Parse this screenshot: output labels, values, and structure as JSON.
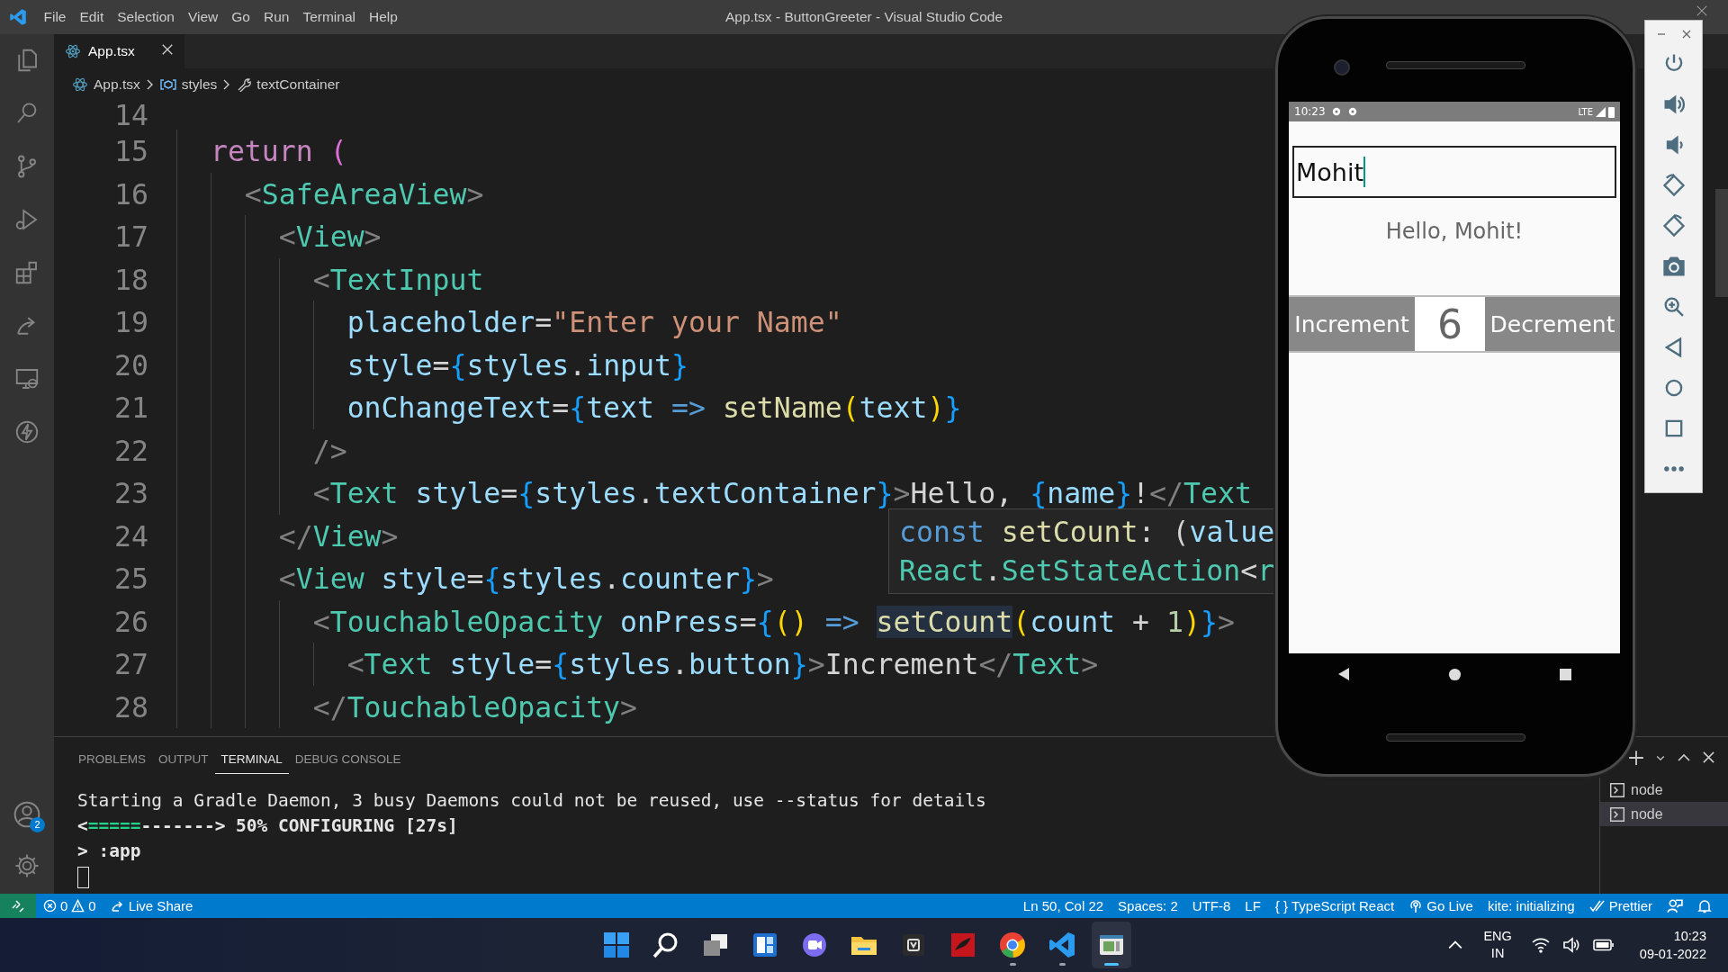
{
  "title_bar": {
    "menu": [
      "File",
      "Edit",
      "Selection",
      "View",
      "Go",
      "Run",
      "Terminal",
      "Help"
    ],
    "title": "App.tsx - ButtonGreeter - Visual Studio Code"
  },
  "activity_bar": {
    "account_badge": "2"
  },
  "editor": {
    "tabs": [
      {
        "label": "App.tsx",
        "selected": true
      }
    ],
    "breadcrumbs": [
      "App.tsx",
      "styles",
      "textContainer"
    ],
    "lines": [
      {
        "number": "14"
      },
      {
        "number": "15",
        "tokens": [
          {
            "text": "  return ",
            "kind": "kw"
          },
          {
            "text": "(",
            "kind": "paren"
          }
        ]
      },
      {
        "number": "16",
        "tokens": [
          {
            "text": "    <",
            "kind": "punct"
          },
          {
            "text": "SafeAreaView",
            "kind": "tag"
          },
          {
            "text": ">",
            "kind": "punct"
          }
        ]
      },
      {
        "number": "17",
        "tokens": [
          {
            "text": "      <",
            "kind": "punct"
          },
          {
            "text": "View",
            "kind": "tag"
          },
          {
            "text": ">",
            "kind": "punct"
          }
        ]
      },
      {
        "number": "18",
        "tokens": [
          {
            "text": "        <",
            "kind": "punct"
          },
          {
            "text": "TextInput",
            "kind": "tag"
          }
        ]
      },
      {
        "number": "19",
        "tokens": [
          {
            "text": "          placeholder",
            "kind": "attr"
          },
          {
            "text": "=",
            "kind": "plain"
          },
          {
            "text": "\"Enter your Name\"",
            "kind": "str"
          }
        ]
      },
      {
        "number": "20",
        "tokens": [
          {
            "text": "          style",
            "kind": "attr"
          },
          {
            "text": "=",
            "kind": "plain"
          },
          {
            "text": "{",
            "kind": "brace"
          },
          {
            "text": "styles",
            "kind": "attr"
          },
          {
            "text": ".",
            "kind": "plain"
          },
          {
            "text": "input",
            "kind": "attr"
          },
          {
            "text": "}",
            "kind": "brace"
          }
        ]
      },
      {
        "number": "21",
        "tokens": [
          {
            "text": "          onChangeText",
            "kind": "attr"
          },
          {
            "text": "=",
            "kind": "plain"
          },
          {
            "text": "{",
            "kind": "brace"
          },
          {
            "text": "text ",
            "kind": "attr"
          },
          {
            "text": "=> ",
            "kind": "arrow"
          },
          {
            "text": "setName",
            "kind": "fn"
          },
          {
            "text": "(",
            "kind": "bracket"
          },
          {
            "text": "text",
            "kind": "attr"
          },
          {
            "text": ")",
            "kind": "bracket"
          },
          {
            "text": "}",
            "kind": "brace"
          }
        ]
      },
      {
        "number": "22",
        "tokens": [
          {
            "text": "        />",
            "kind": "punct"
          }
        ]
      },
      {
        "number": "23",
        "tokens": [
          {
            "text": "        <",
            "kind": "punct"
          },
          {
            "text": "Text",
            "kind": "tag"
          },
          {
            "text": " style",
            "kind": "attr"
          },
          {
            "text": "=",
            "kind": "plain"
          },
          {
            "text": "{",
            "kind": "brace"
          },
          {
            "text": "styles",
            "kind": "attr"
          },
          {
            "text": ".",
            "kind": "plain"
          },
          {
            "text": "textContainer",
            "kind": "attr"
          },
          {
            "text": "}",
            "kind": "brace"
          },
          {
            "text": ">",
            "kind": "punct"
          },
          {
            "text": "Hello, ",
            "kind": "plain"
          },
          {
            "text": "{",
            "kind": "brace"
          },
          {
            "text": "name",
            "kind": "attr"
          },
          {
            "text": "}",
            "kind": "brace"
          },
          {
            "text": "!",
            "kind": "plain"
          },
          {
            "text": "</",
            "kind": "punct"
          },
          {
            "text": "Text",
            "kind": "tag"
          }
        ]
      },
      {
        "number": "24",
        "tokens": [
          {
            "text": "      </",
            "kind": "punct"
          },
          {
            "text": "View",
            "kind": "tag"
          },
          {
            "text": ">",
            "kind": "punct"
          }
        ]
      },
      {
        "number": "25",
        "tokens": [
          {
            "text": "      <",
            "kind": "punct"
          },
          {
            "text": "View",
            "kind": "tag"
          },
          {
            "text": " style",
            "kind": "attr"
          },
          {
            "text": "=",
            "kind": "plain"
          },
          {
            "text": "{",
            "kind": "brace"
          },
          {
            "text": "styles",
            "kind": "attr"
          },
          {
            "text": ".",
            "kind": "plain"
          },
          {
            "text": "counter",
            "kind": "attr"
          },
          {
            "text": "}",
            "kind": "brace"
          },
          {
            "text": ">",
            "kind": "punct"
          }
        ]
      },
      {
        "number": "26",
        "tokens": [
          {
            "text": "        <",
            "kind": "punct"
          },
          {
            "text": "TouchableOpacity",
            "kind": "tag"
          },
          {
            "text": " onPress",
            "kind": "attr"
          },
          {
            "text": "=",
            "kind": "plain"
          },
          {
            "text": "{",
            "kind": "brace"
          },
          {
            "text": "() ",
            "kind": "bracket"
          },
          {
            "text": "=> ",
            "kind": "arrow"
          },
          {
            "text": "setCount",
            "kind": "match"
          },
          {
            "text": "(",
            "kind": "bracket"
          },
          {
            "text": "count ",
            "kind": "attr"
          },
          {
            "text": "+ ",
            "kind": "plain"
          },
          {
            "text": "1",
            "kind": "num"
          },
          {
            "text": ")",
            "kind": "bracket"
          },
          {
            "text": "}",
            "kind": "brace"
          },
          {
            "text": ">",
            "kind": "punct"
          }
        ]
      },
      {
        "number": "27",
        "tokens": [
          {
            "text": "          <",
            "kind": "punct"
          },
          {
            "text": "Text",
            "kind": "tag"
          },
          {
            "text": " style",
            "kind": "attr"
          },
          {
            "text": "=",
            "kind": "plain"
          },
          {
            "text": "{",
            "kind": "brace"
          },
          {
            "text": "styles",
            "kind": "attr"
          },
          {
            "text": ".",
            "kind": "plain"
          },
          {
            "text": "button",
            "kind": "attr"
          },
          {
            "text": "}",
            "kind": "brace"
          },
          {
            "text": ">",
            "kind": "punct"
          },
          {
            "text": "Increment",
            "kind": "plain"
          },
          {
            "text": "</",
            "kind": "punct"
          },
          {
            "text": "Text",
            "kind": "tag"
          },
          {
            "text": ">",
            "kind": "punct"
          }
        ]
      },
      {
        "number": "28",
        "tokens": [
          {
            "text": "        </",
            "kind": "punct"
          },
          {
            "text": "TouchableOpacity",
            "kind": "tag"
          },
          {
            "text": ">",
            "kind": "punct"
          }
        ]
      }
    ],
    "hover": [
      {
        "tokens": [
          {
            "text": "const ",
            "kind": "arrow"
          },
          {
            "text": "setCount",
            "kind": "fn"
          },
          {
            "text": ": (",
            "kind": "plain"
          },
          {
            "text": "value",
            "kind": "attr"
          }
        ]
      },
      {
        "tokens": [
          {
            "text": "React",
            "kind": "tag"
          },
          {
            "text": ".",
            "kind": "plain"
          },
          {
            "text": "SetStateAction",
            "kind": "tag"
          },
          {
            "text": "<",
            "kind": "plain"
          },
          {
            "text": "r",
            "kind": "tag"
          }
        ]
      }
    ]
  },
  "panel": {
    "tabs": [
      {
        "label": "PROBLEMS",
        "selected": false
      },
      {
        "label": "OUTPUT",
        "selected": false
      },
      {
        "label": "TERMINAL",
        "selected": true
      },
      {
        "label": "DEBUG CONSOLE",
        "selected": false
      }
    ],
    "terminal_lines": [
      {
        "bold": false,
        "segments": [
          {
            "text": "Starting a Gradle Daemon, 3 busy Daemons could not be reused, use --status for details",
            "kind": "plain"
          }
        ]
      },
      {
        "bold": true,
        "segments": [
          {
            "text": "<",
            "kind": "plain"
          },
          {
            "text": "=====",
            "kind": "progress"
          },
          {
            "text": "-------> 50% CONFIGURING [27s]",
            "kind": "plain"
          }
        ]
      },
      {
        "bold": true,
        "segments": [
          {
            "text": "> :app",
            "kind": "plain"
          }
        ]
      }
    ],
    "terminals": [
      {
        "label": "node",
        "selected": false
      },
      {
        "label": "node",
        "selected": true
      }
    ]
  },
  "status_bar": {
    "errors": "0",
    "warnings": "0",
    "live_share": "Live Share",
    "position": "Ln 50, Col 22",
    "spaces": "Spaces: 2",
    "encoding": "UTF-8",
    "eol": "LF",
    "language_icon": "{ }",
    "language": "TypeScript React",
    "go_live": "Go Live",
    "kite": "kite: initializing",
    "prettier": "Prettier"
  },
  "emulator": {
    "time": "10:23",
    "network": "LTE",
    "name_input": {
      "value": "Mohit"
    },
    "greeting": "Hello, Mohit!",
    "increment": "Increment",
    "count": "6",
    "decrement": "Decrement"
  },
  "taskbar": {
    "apps": [
      {
        "running": false,
        "active": false
      },
      {
        "running": false,
        "active": false
      },
      {
        "running": false,
        "active": false
      },
      {
        "running": false,
        "active": false
      },
      {
        "running": false,
        "active": false
      },
      {
        "running": false,
        "active": false
      },
      {
        "running": false,
        "active": false
      },
      {
        "running": false,
        "active": false
      },
      {
        "running": true,
        "active": false
      },
      {
        "running": true,
        "active": false
      },
      {
        "running": true,
        "active": true
      }
    ],
    "language": "ENG",
    "region": "IN",
    "time": "10:23",
    "date": "09-01-2022"
  }
}
